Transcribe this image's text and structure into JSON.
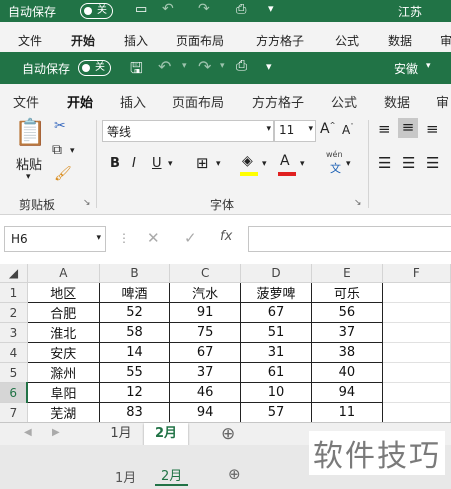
{
  "bg_title": {
    "autosave": "自动保存",
    "toggle": "关",
    "user": "江苏"
  },
  "bg_tabs": [
    "文件",
    "开始",
    "插入",
    "页面布局",
    "方方格子",
    "公式",
    "数据",
    "审"
  ],
  "bg_sheet_tabs": [
    "1月",
    "2月"
  ],
  "title": {
    "autosave": "自动保存",
    "toggle": "关",
    "user": "安徽"
  },
  "tabs": [
    "文件",
    "开始",
    "插入",
    "页面布局",
    "方方格子",
    "公式",
    "数据",
    "审"
  ],
  "active_tab": "开始",
  "clipboard": {
    "paste": "粘贴",
    "group": "剪贴板"
  },
  "font": {
    "name": "等线",
    "size": "11",
    "group": "字体",
    "bold": "B",
    "italic": "I",
    "underline": "U",
    "grow": "A",
    "shrink": "A",
    "wen": "wén",
    "wen_char": "文",
    "font_color": "A"
  },
  "colors": {
    "accent": "#217346",
    "highlight": "#ffff00",
    "font_red": "#e02020"
  },
  "formula_bar": {
    "cell_ref": "H6",
    "value": "",
    "fx": "fx"
  },
  "columns": [
    "A",
    "B",
    "C",
    "D",
    "E",
    "F"
  ],
  "rows": [
    "1",
    "2",
    "3",
    "4",
    "5",
    "6",
    "7",
    "8"
  ],
  "selected_row": "6",
  "table": [
    [
      "地区",
      "啤酒",
      "汽水",
      "菠萝啤",
      "可乐"
    ],
    [
      "合肥",
      "52",
      "91",
      "67",
      "56"
    ],
    [
      "淮北",
      "58",
      "75",
      "51",
      "37"
    ],
    [
      "安庆",
      "14",
      "67",
      "31",
      "38"
    ],
    [
      "滁州",
      "55",
      "37",
      "61",
      "40"
    ],
    [
      "阜阳",
      "12",
      "46",
      "10",
      "94"
    ],
    [
      "芜湖",
      "83",
      "94",
      "57",
      "11"
    ]
  ],
  "sheet_tabs": [
    "1月",
    "2月"
  ],
  "active_sheet": "2月",
  "add_sheet": "⊕",
  "watermark": "软件技巧"
}
